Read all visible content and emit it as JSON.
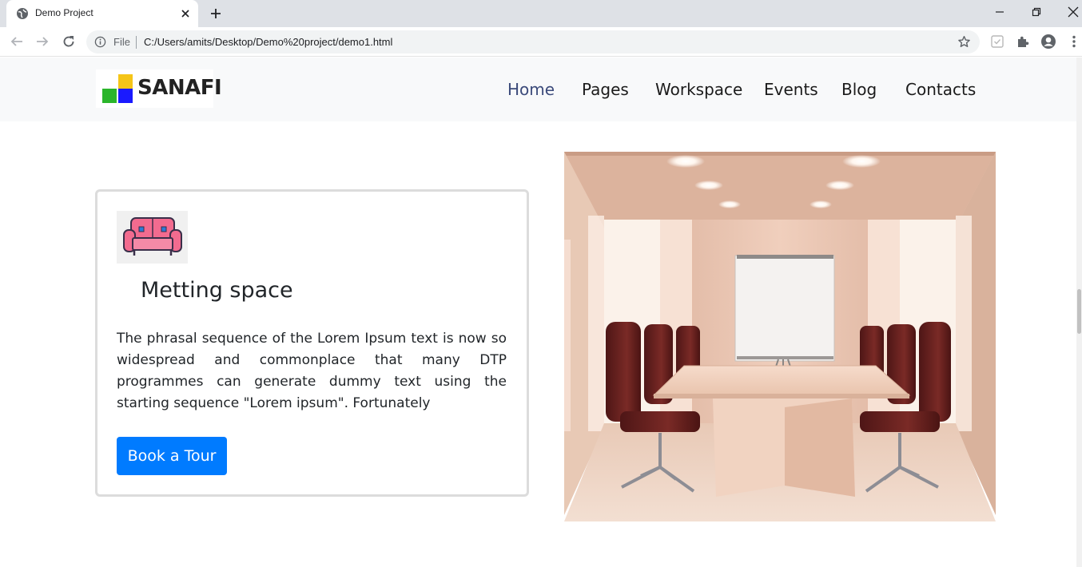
{
  "browser": {
    "tab_title": "Demo Project",
    "file_label": "File",
    "url": "C:/Users/amits/Desktop/Demo%20project/demo1.html"
  },
  "site": {
    "logo_text": "SANAFI",
    "logo_colors": [
      "#f5c518",
      "#2bb52b",
      "#1a1aff"
    ],
    "nav": [
      {
        "label": "Home",
        "active": true
      },
      {
        "label": "Pages"
      },
      {
        "label": "Workspace"
      },
      {
        "label": "Events"
      },
      {
        "label": "Blog"
      },
      {
        "label": "Contacts"
      }
    ]
  },
  "card": {
    "icon": "sofa-icon",
    "title": "Metting space",
    "text": "The phrasal sequence of the Lorem Ipsum text is now so widespread and commonplace that many DTP programmes can generate dummy text using the starting sequence \"Lorem ipsum\". Fortunately",
    "button_label": "Book a Tour",
    "button_color": "#007bff"
  },
  "image": {
    "description_icon": "meeting-room-illustration"
  }
}
